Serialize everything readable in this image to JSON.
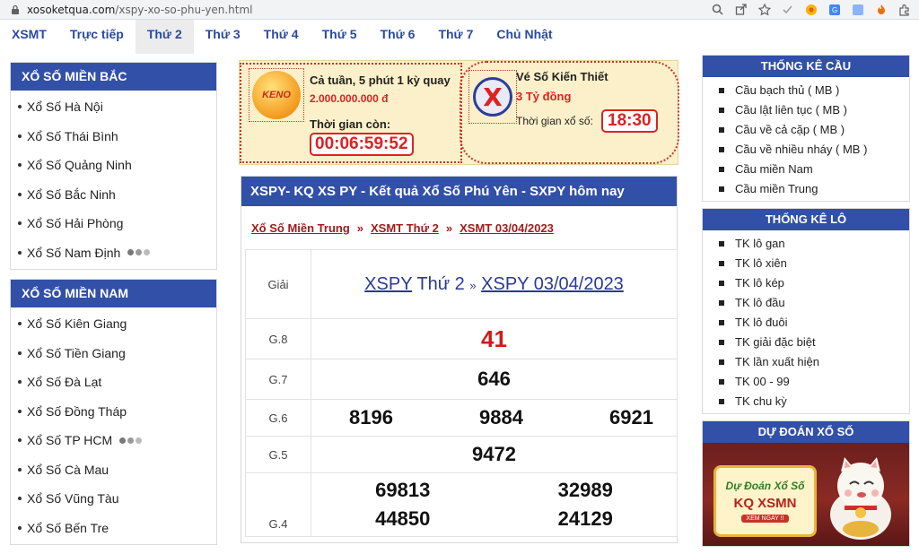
{
  "browser": {
    "url_host": "xosoketqua.com",
    "url_path": "/xspy-xo-so-phu-yen.html"
  },
  "nav": {
    "items": [
      "XSMT",
      "Trực tiếp",
      "Thứ 2",
      "Thứ 3",
      "Thứ 4",
      "Thứ 5",
      "Thứ 6",
      "Thứ 7",
      "Chủ Nhật"
    ],
    "active_index": 2
  },
  "sidebar_left": {
    "north": {
      "title": "XỔ SỐ MIỀN BẮC",
      "items": [
        "Xổ Số Hà Nội",
        "Xổ Số Thái Bình",
        "Xổ Số Quảng Ninh",
        "Xổ Số Bắc Ninh",
        "Xổ Số Hải Phòng",
        "Xổ Số Nam Định"
      ]
    },
    "south": {
      "title": "XỔ SỐ MIỀN NAM",
      "items": [
        "Xổ Số Kiên Giang",
        "Xổ Số Tiền Giang",
        "Xổ Số Đà Lạt",
        "Xổ Số Đồng Tháp",
        "Xổ Số TP HCM",
        "Xổ Số Cà Mau",
        "Xổ Số Vũng Tàu",
        "Xổ Số Bến Tre"
      ]
    }
  },
  "promo": {
    "keno": {
      "logo_text": "KENO",
      "title": "Cả tuần, 5 phút 1 kỳ quay",
      "prize": "2.000.000.000 đ",
      "countdown_label": "Thời gian còn:",
      "countdown": "00:06:59:52"
    },
    "vkt": {
      "logo_text": "X",
      "title": "Vé Số Kiến Thiết",
      "prize": "3 Tỷ đồng",
      "time_label": "Thời gian xổ số:",
      "time": "18:30"
    }
  },
  "main": {
    "title": "XSPY- KQ XS PY - Kết quả Xổ Số Phú Yên - SXPY hôm nay",
    "breadcrumb": [
      "Xổ Số Miền Trung",
      "XSMT Thứ 2",
      "XSMT 03/04/2023"
    ],
    "breadcrumb_sep": "»",
    "table": {
      "col_label": "Giải",
      "header_link1": "XSPY",
      "header_day": "Thứ 2",
      "header_sep": "»",
      "header_link2": "XSPY 03/04/2023",
      "rows": {
        "g8": {
          "label": "G.8",
          "values": [
            "41"
          ]
        },
        "g7": {
          "label": "G.7",
          "values": [
            "646"
          ]
        },
        "g6": {
          "label": "G.6",
          "values": [
            "8196",
            "9884",
            "6921"
          ]
        },
        "g5": {
          "label": "G.5",
          "values": [
            "9472"
          ]
        },
        "g4": {
          "label": "G.4",
          "values": [
            "69813",
            "32989",
            "44850",
            "24129"
          ]
        }
      }
    }
  },
  "sidebar_right": {
    "cau": {
      "title": "THỐNG KÊ CẦU",
      "items": [
        "Cầu bạch thủ ( MB )",
        "Cầu lật liên tục ( MB )",
        "Cầu về cả cặp ( MB )",
        "Cầu về nhiều nháy ( MB )",
        "Cầu miền Nam",
        "Cầu miền Trung"
      ]
    },
    "lo": {
      "title": "THỐNG KÊ LÔ",
      "items": [
        "TK lô gan",
        "TK lô xiên",
        "TK lô kép",
        "TK lô đầu",
        "TK lô đuôi",
        "TK giải đặc biệt",
        "TK lần xuất hiện",
        "TK 00 - 99",
        "TK chu kỳ"
      ]
    },
    "predict": {
      "title": "DỰ ĐOÁN XỔ SỐ",
      "banner_line1": "Dự Đoán Xổ Số",
      "banner_line2": "KQ XSMN",
      "banner_button": "XEM NGAY !!"
    }
  },
  "colors": {
    "header_blue": "#3250a8",
    "nav_blue": "#2a4aa0",
    "result_red": "#d21a1a",
    "promo_bg": "#fbf0c9"
  }
}
